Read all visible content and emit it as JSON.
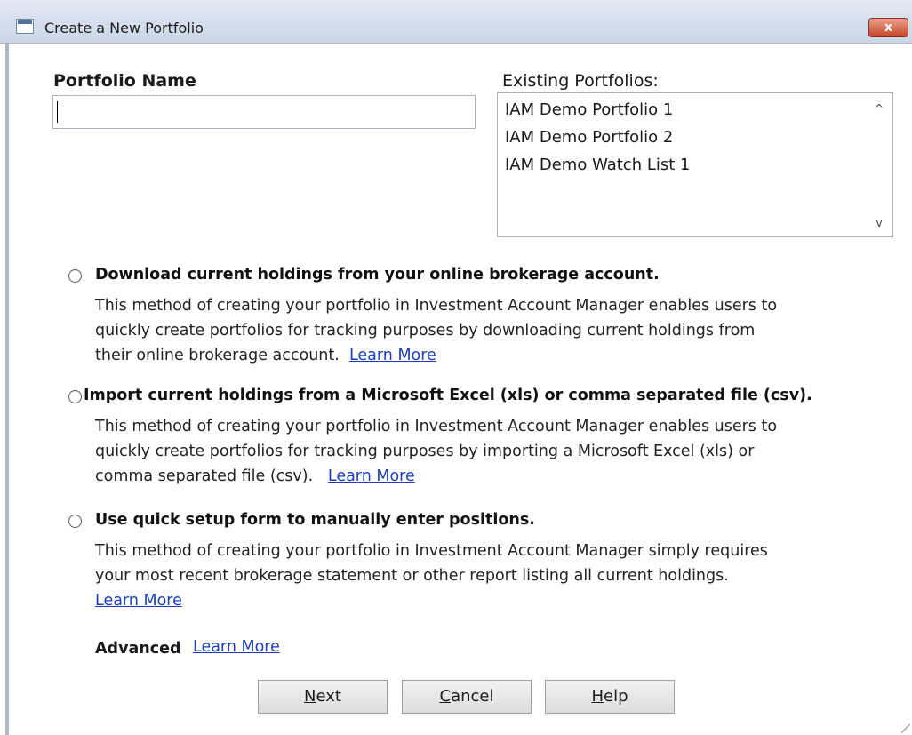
{
  "window": {
    "title": "Create a New Portfolio",
    "close_glyph": "x"
  },
  "portfolio_name": {
    "label": "Portfolio Name",
    "value": ""
  },
  "existing": {
    "label": "Existing Portfolios:",
    "items": [
      "IAM Demo Portfolio 1",
      "IAM Demo Portfolio 2",
      "IAM Demo Watch List 1"
    ],
    "scroll_up_glyph": "^",
    "scroll_down_glyph": "v"
  },
  "options": [
    {
      "title": "Download current holdings from your online brokerage account.",
      "desc_lines": [
        "This method of creating your portfolio in Investment Account Manager enables users to",
        "quickly create portfolios for tracking purposes by downloading current holdings from",
        "their online brokerage account."
      ],
      "link": "Learn More",
      "selected": false
    },
    {
      "title": "Import current holdings from a Microsoft Excel (xls) or comma separated file (csv).",
      "desc_lines": [
        "This method of creating your portfolio in Investment Account Manager enables users to",
        "quickly create portfolios for tracking purposes by importing a Microsoft Excel (xls) or",
        "comma separated file (csv)."
      ],
      "link": "Learn More",
      "selected": false
    },
    {
      "title": "Use quick setup form to manually enter positions.",
      "desc_lines": [
        "This method of creating your portfolio in Investment Account Manager simply requires",
        "your most recent brokerage statement or other report listing all current holdings."
      ],
      "link": "Learn More",
      "selected": false
    }
  ],
  "advanced": {
    "label": "Advanced",
    "link": "Learn More"
  },
  "buttons": {
    "next": {
      "mnemonic": "N",
      "rest": "ext"
    },
    "cancel": {
      "mnemonic": "C",
      "rest": "ancel"
    },
    "help": {
      "mnemonic": "H",
      "rest": "elp"
    }
  }
}
